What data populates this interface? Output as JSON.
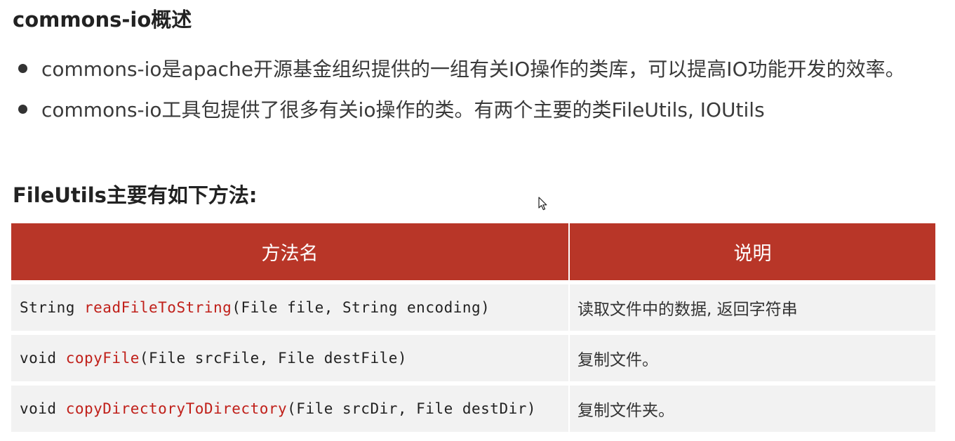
{
  "heading": "commons-io概述",
  "bullets": [
    "commons-io是apache开源基金组织提供的一组有关IO操作的类库，可以提高IO功能开发的效率。",
    "commons-io工具包提供了很多有关io操作的类。有两个主要的类FileUtils, IOUtils"
  ],
  "subheading": "FileUtils主要有如下方法:",
  "table": {
    "headers": [
      "方法名",
      "说明"
    ],
    "rows": [
      {
        "return_type": "String ",
        "method": "readFileToString",
        "params": "(File file, String encoding)",
        "description": "读取文件中的数据, 返回字符串"
      },
      {
        "return_type": "void ",
        "method": "copyFile",
        "params": "(File srcFile, File destFile)",
        "description": "复制文件。"
      },
      {
        "return_type": "void ",
        "method": "copyDirectoryToDirectory",
        "params": "(File srcDir, File destDir)",
        "description": "复制文件夹。"
      }
    ]
  },
  "colors": {
    "header_bg": "#b83628",
    "method_name": "#c0201a",
    "row_bg": "#f2f2f2"
  },
  "icons": {
    "cursor": "mouse-pointer-icon"
  }
}
